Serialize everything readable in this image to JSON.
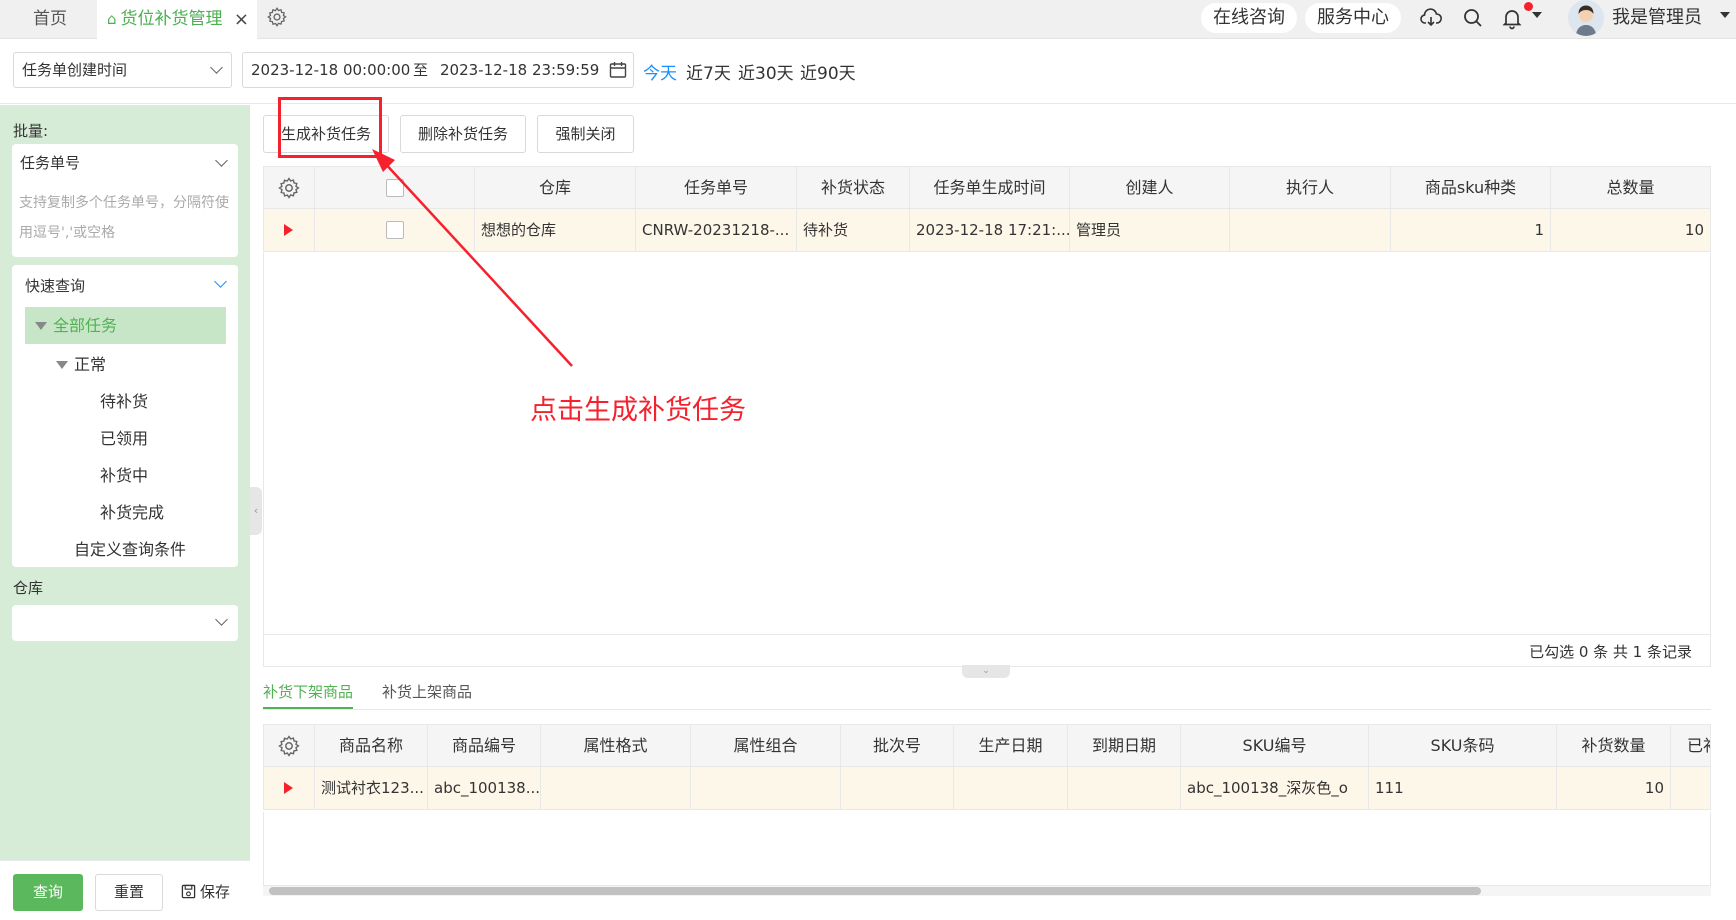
{
  "tabs": {
    "home": "首页",
    "active": "货位补货管理",
    "close_icon": "×"
  },
  "header": {
    "online_consult": "在线咨询",
    "service_center": "服务中心",
    "username": "我是管理员",
    "notification_dot_color": "#f5222d"
  },
  "filter": {
    "date_type": "任务单创建时间",
    "date_start": "2023-12-18 00:00:00",
    "date_sep": "至",
    "date_end": "2023-12-18 23:59:59",
    "quick_today": "今天",
    "quick_7": "近7天",
    "quick_30": "近30天",
    "quick_90": "近90天"
  },
  "sidebar": {
    "batch_label": "批量:",
    "order_field": "任务单号",
    "order_placeholder": "支持复制多个任务单号，分隔符使用逗号','或空格",
    "quick_query": "快速查询",
    "tree": {
      "all": "全部任务",
      "normal": "正常",
      "pending": "待补货",
      "claimed": "已领用",
      "in_progress": "补货中",
      "done": "补货完成",
      "custom": "自定义查询条件"
    },
    "warehouse_label": "仓库",
    "warehouse_value": "",
    "btn_query": "查询",
    "btn_reset": "重置",
    "btn_save": "保存"
  },
  "toolbar": {
    "generate": "生成补货任务",
    "delete": "删除补货任务",
    "force_close": "强制关闭"
  },
  "task_table": {
    "columns": [
      "仓库",
      "任务单号",
      "补货状态",
      "任务单生成时间",
      "创建人",
      "执行人",
      "商品sku种类",
      "总数量"
    ],
    "rows": [
      {
        "warehouse": "想想的仓库",
        "order_no": "CNRW-20231218-...",
        "status": "待补货",
        "created_at": "2023-12-18 17:21:...",
        "creator": "管理员",
        "executor": "",
        "sku_kinds": "1",
        "total_qty": "10"
      }
    ],
    "summary": "已勾选 0 条  共 1 条记录"
  },
  "detail_tabs": {
    "down": "补货下架商品",
    "up": "补货上架商品"
  },
  "detail_table": {
    "columns": [
      "商品名称",
      "商品编号",
      "属性格式",
      "属性组合",
      "批次号",
      "生产日期",
      "到期日期",
      "SKU编号",
      "SKU条码",
      "补货数量",
      "已补"
    ],
    "rows": [
      {
        "name": "测试衬衣123...",
        "code": "abc_100138...",
        "attr_format": "",
        "attr_combo": "",
        "batch": "",
        "prod_date": "",
        "exp_date": "",
        "sku_no": "abc_100138_深灰色_o",
        "sku_barcode": "111",
        "qty": "10",
        "done": ""
      }
    ]
  },
  "annotation": {
    "text": "点击生成补货任务",
    "color": "#f5222d"
  }
}
